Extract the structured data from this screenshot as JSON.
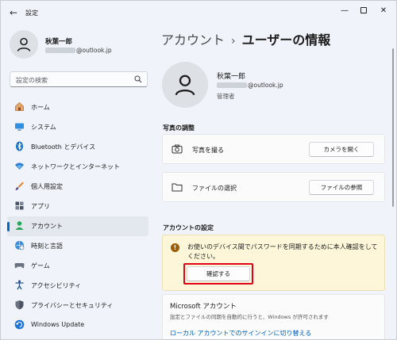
{
  "window": {
    "title": "設定",
    "back_glyph": "←",
    "minimize_glyph": "—",
    "close_glyph": "✕"
  },
  "profile": {
    "name": "秋葉一郎",
    "email_suffix": "@outlook.jp"
  },
  "search": {
    "placeholder": "設定の検索"
  },
  "sidebar": {
    "items": [
      {
        "label": "ホーム",
        "icon": "home-icon"
      },
      {
        "label": "システム",
        "icon": "monitor-icon"
      },
      {
        "label": "Bluetooth とデバイス",
        "icon": "bluetooth-icon"
      },
      {
        "label": "ネットワークとインターネット",
        "icon": "wifi-icon"
      },
      {
        "label": "個人用設定",
        "icon": "brush-icon"
      },
      {
        "label": "アプリ",
        "icon": "apps-icon"
      },
      {
        "label": "アカウント",
        "icon": "account-icon",
        "active": true
      },
      {
        "label": "時刻と言語",
        "icon": "globe-clock-icon"
      },
      {
        "label": "ゲーム",
        "icon": "gamepad-icon"
      },
      {
        "label": "アクセシビリティ",
        "icon": "accessibility-icon"
      },
      {
        "label": "プライバシーとセキュリティ",
        "icon": "shield-icon"
      },
      {
        "label": "Windows Update",
        "icon": "update-icon"
      }
    ]
  },
  "breadcrumb": {
    "parent": "アカウント",
    "separator": "›",
    "current": "ユーザーの情報"
  },
  "user": {
    "name": "秋葉一郎",
    "email_suffix": "@outlook.jp",
    "role": "管理者"
  },
  "photo_section": {
    "title": "写真の調整",
    "take_photo_label": "写真を撮る",
    "camera_button": "カメラを開く",
    "choose_file_label": "ファイルの選択",
    "browse_button": "ファイルの参照"
  },
  "account_section": {
    "title": "アカウントの設定",
    "alert_text": "お使いのデバイス間でパスワードを同期するために本人確認をしてください。",
    "confirm_button": "確認する",
    "ms_title": "Microsoft アカウント",
    "ms_desc": "設定とファイルの同期を自動的に行うと、Windows が許可されます",
    "ms_link": "ローカル アカウントでのサインインに切り替える"
  },
  "colors": {
    "accent": "#0067c0",
    "highlight": "#e0001a",
    "alert_bg": "#fdf6d8"
  }
}
